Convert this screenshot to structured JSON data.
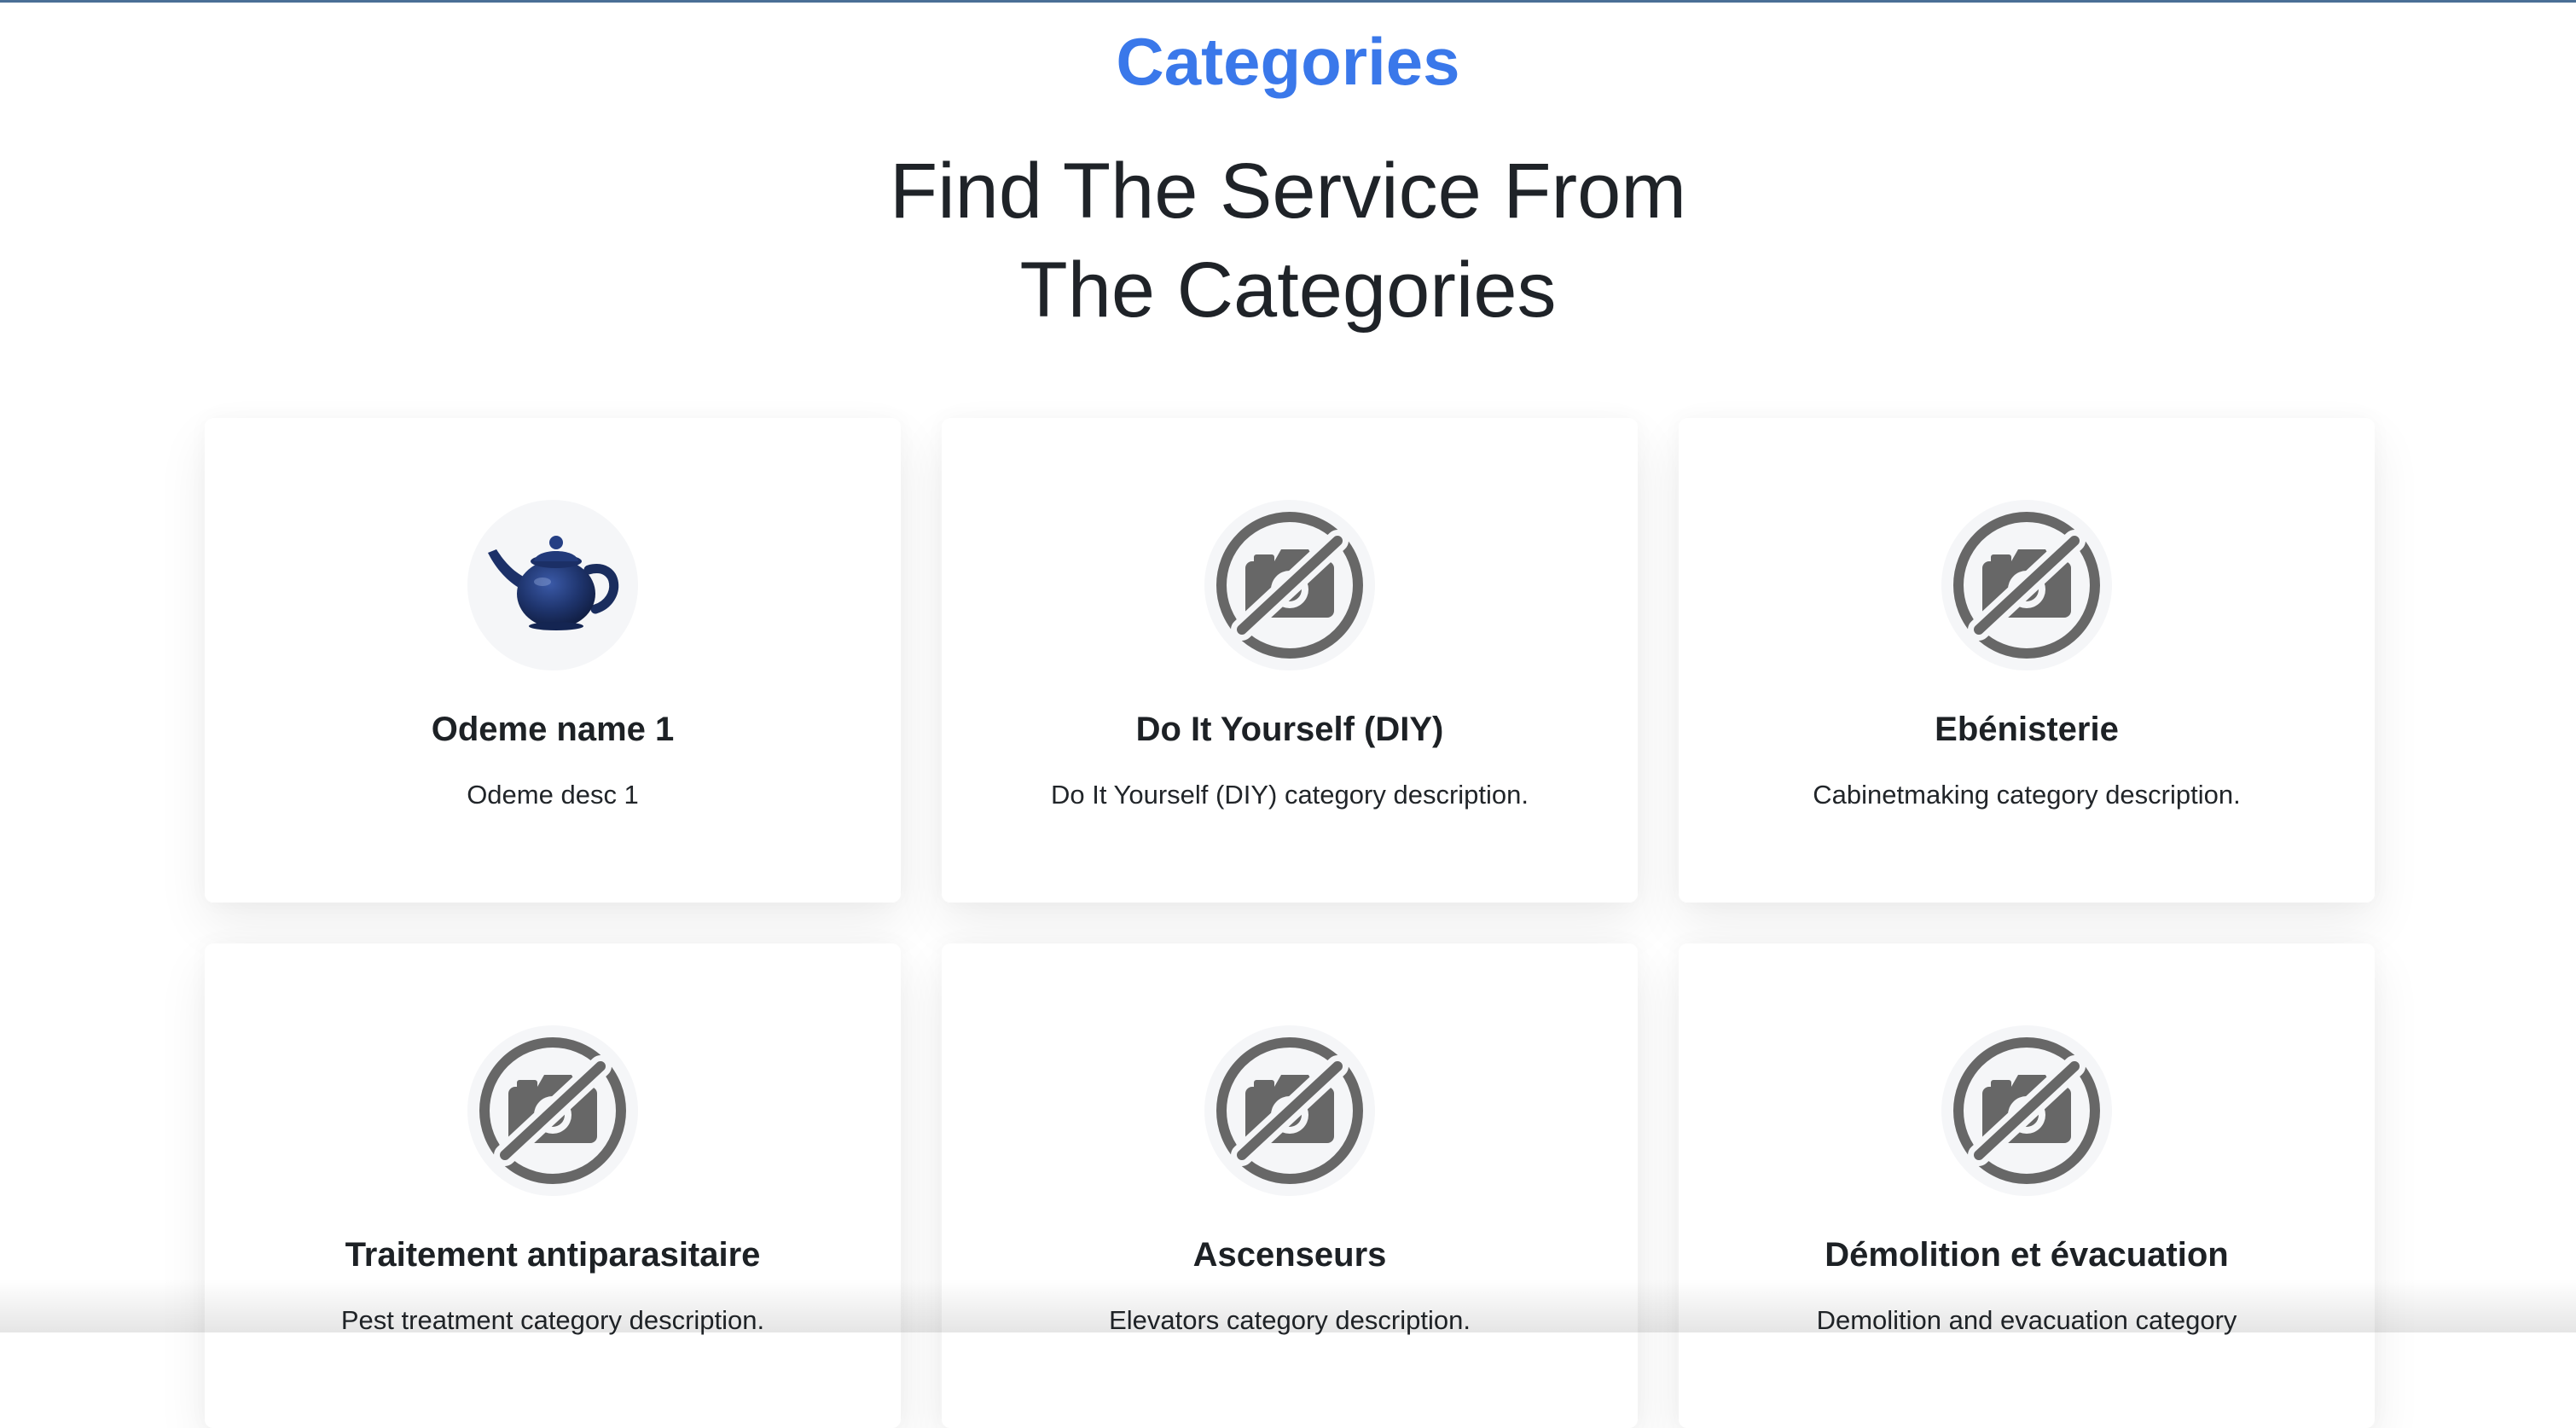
{
  "section": {
    "label": "Categories",
    "title_line1": "Find The Service From",
    "title_line2": "The Categories"
  },
  "categories": [
    {
      "title": "Odeme name 1",
      "desc": "Odeme desc 1",
      "image": "teapot-image"
    },
    {
      "title": "Do It Yourself (DIY)",
      "desc": "Do It Yourself (DIY) category description.",
      "image": "no-photo-icon"
    },
    {
      "title": "Ebénisterie",
      "desc": "Cabinetmaking category description.",
      "image": "no-photo-icon"
    },
    {
      "title": "Traitement antiparasitaire",
      "desc": "Pest treatment category description.",
      "image": "no-photo-icon"
    },
    {
      "title": "Ascenseurs",
      "desc": "Elevators category description.",
      "image": "no-photo-icon"
    },
    {
      "title": "Démolition et évacuation",
      "desc": "Demolition and evacuation category",
      "image": "no-photo-icon"
    }
  ],
  "colors": {
    "accent": "#3a78ea",
    "icon_gray": "#676767",
    "teapot_blue": "#1f356e"
  }
}
